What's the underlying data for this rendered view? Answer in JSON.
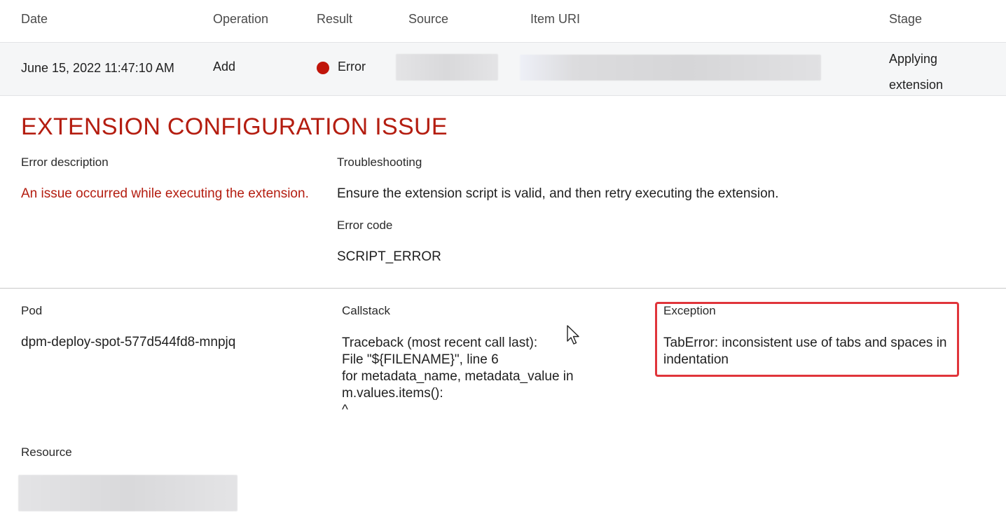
{
  "table": {
    "headers": {
      "date": "Date",
      "operation": "Operation",
      "result": "Result",
      "source": "Source",
      "item_uri": "Item URI",
      "stage": "Stage"
    },
    "row": {
      "date": "June 15, 2022 11:47:10 AM",
      "operation": "Add",
      "result": "Error",
      "stage_line1": "Applying",
      "stage_line2": "extension"
    }
  },
  "details": {
    "title": "EXTENSION CONFIGURATION ISSUE",
    "error_description_label": "Error description",
    "error_description": "An issue occurred while executing the extension.",
    "troubleshooting_label": "Troubleshooting",
    "troubleshooting": "Ensure the extension script is valid, and then retry executing the extension.",
    "error_code_label": "Error code",
    "error_code": "SCRIPT_ERROR",
    "pod_label": "Pod",
    "pod": "dpm-deploy-spot-577d544fd8-mnpjq",
    "callstack_label": "Callstack",
    "callstack": "Traceback (most recent call last):\nFile \"${FILENAME}\", line 6\nfor metadata_name, metadata_value in\nm.values.items():\n^",
    "exception_label": "Exception",
    "exception": "TabError: inconsistent use of tabs and spaces in\nindentation",
    "resource_label": "Resource"
  },
  "colors": {
    "error_red": "#b41d10",
    "status_dot": "#c0150a",
    "highlight_box": "#e0353b",
    "row_background": "#f5f6f7"
  },
  "icons": {
    "status": "error-dot-icon",
    "cursor": "mouse-pointer-icon"
  }
}
